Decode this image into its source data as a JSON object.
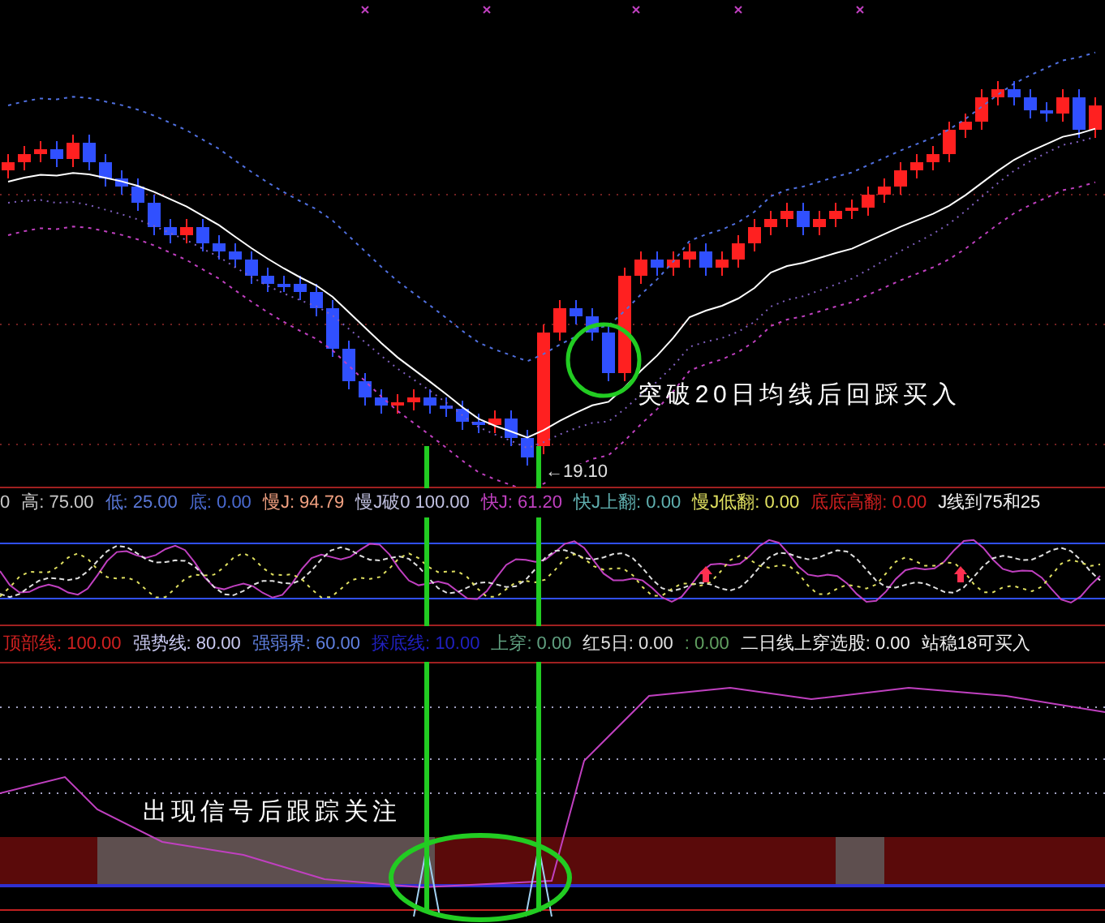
{
  "main_chart": {
    "low_price_label": "←19.10",
    "annotation": "突破20日均线后回踩买入"
  },
  "indicator_1": {
    "readouts": [
      {
        "text": "0",
        "color": "#c8c8c8"
      },
      {
        "text": "高: 75.00",
        "color": "#c8c8c8"
      },
      {
        "text": "低: 25.00",
        "color": "#5a78d8"
      },
      {
        "text": "底: 0.00",
        "color": "#4a6ad0"
      },
      {
        "text": "慢J: 94.79",
        "color": "#f0a080"
      },
      {
        "text": "慢J破0 100.00",
        "color": "#c0c0e0"
      },
      {
        "text": "快J: 61.20",
        "color": "#c040c0"
      },
      {
        "text": "快J上翻: 0.00",
        "color": "#60b0b0"
      },
      {
        "text": "慢J低翻: 0.00",
        "color": "#e0e060"
      },
      {
        "text": "底底高翻: 0.00",
        "color": "#d02020"
      },
      {
        "text": "J线到75和25",
        "color": "#f0f0f0"
      }
    ]
  },
  "indicator_2": {
    "readouts": [
      {
        "text": "顶部线: 100.00",
        "color": "#d02020"
      },
      {
        "text": "强势线: 80.00",
        "color": "#c8c8f0"
      },
      {
        "text": "强弱界: 60.00",
        "color": "#6080e0"
      },
      {
        "text": "探底线: 10.00",
        "color": "#2020c0"
      },
      {
        "text": "上穿: 0.00",
        "color": "#60a080"
      },
      {
        "text": "红5日: 0.00",
        "color": "#e0e0e0"
      },
      {
        "text": ": 0.00",
        "color": "#60a060"
      },
      {
        "text": "二日线上穿选股: 0.00",
        "color": "#f0f0f0"
      },
      {
        "text": "站稳18可买入",
        "color": "#f0f0f0"
      }
    ],
    "annotation": "出现信号后跟踪关注"
  }
}
